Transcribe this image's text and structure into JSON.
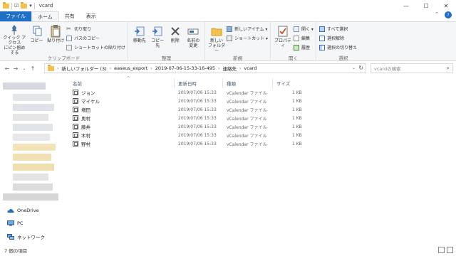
{
  "window": {
    "title": "vcard",
    "controls": [
      "—",
      "☐",
      "✕"
    ]
  },
  "tabs": [
    "ファイル",
    "ホーム",
    "共有",
    "表示"
  ],
  "ribbon": {
    "clipboard": {
      "label": "クリップボード",
      "pin": "クイック アクセス\nにピン留めする",
      "copy": "コピー",
      "paste": "貼り付け",
      "cut": "切り取り",
      "copy_path": "パスのコピー",
      "paste_shortcut": "ショートカットの貼り付け"
    },
    "organize": {
      "label": "整理",
      "move_to": "移動先",
      "copy_to": "コピー先",
      "delete": "削除",
      "rename": "名前の\n変更"
    },
    "new": {
      "label": "新規",
      "new_folder": "新しい\nフォルダー",
      "new_item": "新しいアイテム ▾",
      "shortcut": "ショートカット ▾"
    },
    "open": {
      "label": "開く",
      "properties": "プロパティ",
      "open": "開く ▾",
      "edit": "編集",
      "history": "履歴"
    },
    "select": {
      "label": "選択",
      "select_all": "すべて選択",
      "select_none": "選択解除",
      "invert": "選択の切り替え"
    }
  },
  "address": {
    "crumbs": [
      "新しいフォルダー (3)",
      "easeus_export",
      "2019-07-06-15-33-16-495",
      "連絡先",
      "vcard"
    ],
    "search_placeholder": "vcardの検索"
  },
  "nav": {
    "onedrive": "OneDrive",
    "pc": "PC",
    "network": "ネットワーク"
  },
  "columns": {
    "name": "名前",
    "date": "更新日時",
    "type": "種類",
    "size": "サイズ"
  },
  "files": [
    {
      "name": "ジョン",
      "date": "2019/07/06 15:33",
      "type": "vCalendar ファイル",
      "size": "1 KB"
    },
    {
      "name": "マイケル",
      "date": "2019/07/06 15:33",
      "type": "vCalendar ファイル",
      "size": "1 KB"
    },
    {
      "name": "増田",
      "date": "2019/07/06 15:33",
      "type": "vCalendar ファイル",
      "size": "1 KB"
    },
    {
      "name": "奥村",
      "date": "2019/07/06 15:33",
      "type": "vCalendar ファイル",
      "size": "1 KB"
    },
    {
      "name": "藤井",
      "date": "2019/07/06 15:33",
      "type": "vCalendar ファイル",
      "size": "1 KB"
    },
    {
      "name": "木村",
      "date": "2019/07/06 15:33",
      "type": "vCalendar ファイル",
      "size": "1 KB"
    },
    {
      "name": "野村",
      "date": "2019/07/06 15:33",
      "type": "vCalendar ファイル",
      "size": "1 KB"
    }
  ],
  "status": {
    "count": "7 個の項目"
  },
  "colors": {
    "accent": "#1f6fc5",
    "folder": "#f2c14e"
  }
}
